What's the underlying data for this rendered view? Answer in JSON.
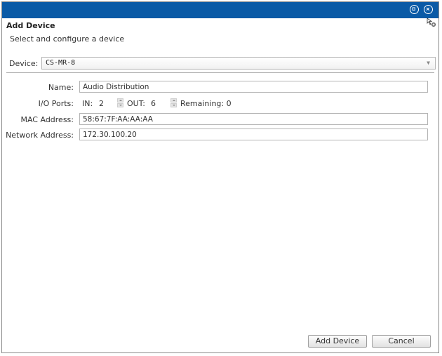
{
  "dialog": {
    "title": "Add Device",
    "subtitle": "Select and configure a device",
    "titlebar_color": "#0a5aa6",
    "titlebar_icons": [
      "restore-icon",
      "close-icon"
    ]
  },
  "device": {
    "label": "Device:",
    "selected": "CS-MR-8"
  },
  "form": {
    "name_label": "Name:",
    "name_value": "Audio Distribution",
    "io_label": "I/O Ports:",
    "in_label": "IN:",
    "in_value": "2",
    "out_label": "OUT:",
    "out_value": "6",
    "remaining_label": "Remaining: 0",
    "mac_label": "MAC Address:",
    "mac_value": "58:67:7F:AA:AA:AA",
    "network_label": "Network Address:",
    "network_value": "172.30.100.20"
  },
  "buttons": {
    "add_label": "Add Device",
    "cancel_label": "Cancel"
  }
}
